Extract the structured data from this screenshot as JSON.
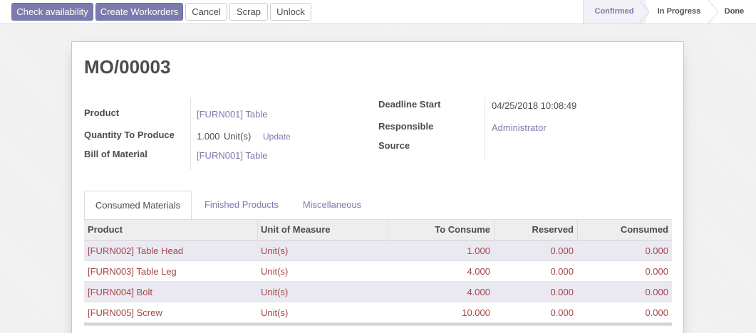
{
  "buttons": {
    "check_availability": "Check availability",
    "create_workorders": "Create Workorders",
    "cancel": "Cancel",
    "scrap": "Scrap",
    "unlock": "Unlock"
  },
  "stages": [
    {
      "label": "Confirmed",
      "active": true
    },
    {
      "label": "In Progress",
      "active": false
    },
    {
      "label": "Done",
      "active": false
    }
  ],
  "record": {
    "title": "MO/00003",
    "fields_left": {
      "product_label": "Product",
      "product_value": "[FURN001] Table",
      "qty_label": "Quantity To Produce",
      "qty_value": "1.000",
      "qty_uom": "Unit(s)",
      "qty_update": "Update",
      "bom_label": "Bill of Material",
      "bom_value": "[FURN001] Table"
    },
    "fields_right": {
      "deadline_label": "Deadline Start",
      "deadline_value": "04/25/2018 10:08:49",
      "responsible_label": "Responsible",
      "responsible_value": "Administrator",
      "source_label": "Source",
      "source_value": ""
    }
  },
  "tabs": [
    {
      "label": "Consumed Materials",
      "active": true
    },
    {
      "label": "Finished Products",
      "active": false
    },
    {
      "label": "Miscellaneous",
      "active": false
    }
  ],
  "table": {
    "headers": [
      "Product",
      "Unit of Measure",
      "To Consume",
      "Reserved",
      "Consumed"
    ],
    "rows": [
      [
        "[FURN002] Table Head",
        "Unit(s)",
        "1.000",
        "0.000",
        "0.000"
      ],
      [
        "[FURN003] Table Leg",
        "Unit(s)",
        "4.000",
        "0.000",
        "0.000"
      ],
      [
        "[FURN004] Bolt",
        "Unit(s)",
        "4.000",
        "0.000",
        "0.000"
      ],
      [
        "[FURN005] Screw",
        "Unit(s)",
        "10.000",
        "0.000",
        "0.000"
      ]
    ]
  },
  "colors": {
    "accent": "#7c7bad",
    "row_text": "#a74545",
    "row_odd_bg": "#eae9f1"
  }
}
